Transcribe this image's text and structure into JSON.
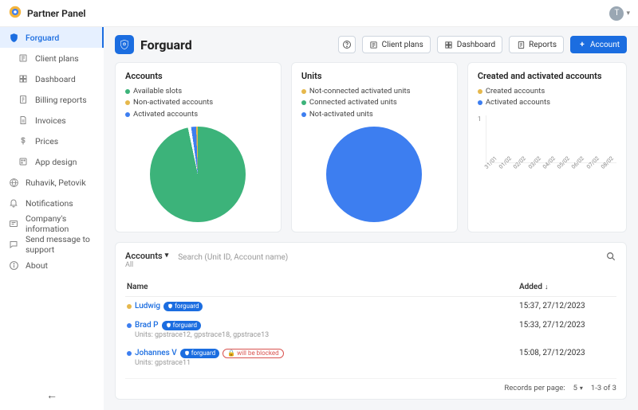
{
  "topbar": {
    "brand": "Partner Panel",
    "avatar_initial": "T"
  },
  "sidebar": {
    "items": [
      {
        "label": "Forguard",
        "icon": "shield-icon",
        "active": true,
        "child": false
      },
      {
        "label": "Client plans",
        "icon": "list-icon",
        "child": true
      },
      {
        "label": "Dashboard",
        "icon": "grid-icon",
        "child": true
      },
      {
        "label": "Billing reports",
        "icon": "report-icon",
        "child": true
      },
      {
        "label": "Invoices",
        "icon": "document-icon",
        "child": true
      },
      {
        "label": "Prices",
        "icon": "dollar-icon",
        "child": true
      },
      {
        "label": "App design",
        "icon": "palette-icon",
        "child": true
      },
      {
        "label": "Ruhavik, Petovik",
        "icon": "globe-icon",
        "child": false
      },
      {
        "label": "Notifications",
        "icon": "bell-icon",
        "child": false
      },
      {
        "label": "Company's information",
        "icon": "info-card-icon",
        "child": false
      },
      {
        "label": "Send message to support",
        "icon": "chat-icon",
        "child": false
      },
      {
        "label": "About",
        "icon": "about-icon",
        "child": false
      }
    ]
  },
  "page": {
    "title": "Forguard"
  },
  "header_buttons": {
    "client_plans": "Client plans",
    "dashboard": "Dashboard",
    "reports": "Reports",
    "account": "Account"
  },
  "cards": {
    "accounts_pie": {
      "title": "Accounts",
      "legend": [
        {
          "label": "Available slots",
          "color": "#3cb37a"
        },
        {
          "label": "Non-activated accounts",
          "color": "#e6b84c"
        },
        {
          "label": "Activated accounts",
          "color": "#3d7ef0"
        }
      ]
    },
    "units_pie": {
      "title": "Units",
      "legend": [
        {
          "label": "Not-connected activated units",
          "color": "#e6b84c"
        },
        {
          "label": "Connected activated units",
          "color": "#3cb37a"
        },
        {
          "label": "Not-activated units",
          "color": "#3d7ef0"
        }
      ]
    },
    "created": {
      "title": "Created and activated accounts",
      "legend": [
        {
          "label": "Created accounts",
          "color": "#e6b84c"
        },
        {
          "label": "Activated accounts",
          "color": "#3d7ef0"
        }
      ],
      "y_tick": "1",
      "x_ticks": [
        "31/01",
        "01/02",
        "02/02",
        "03/02",
        "04/02",
        "05/02",
        "06/02",
        "07/02",
        "08/02"
      ]
    }
  },
  "table": {
    "title": "Accounts",
    "filter": "All",
    "search_placeholder": "Search (Unit ID, Account name)",
    "columns": {
      "name": "Name",
      "added": "Added"
    },
    "rows": [
      {
        "status_color": "#e6b84c",
        "name": "Ludwig",
        "chips": [
          "forguard"
        ],
        "units": "",
        "added": "15:37, 27/12/2023"
      },
      {
        "status_color": "#3d7ef0",
        "name": "Brad P",
        "chips": [
          "forguard"
        ],
        "units": "Units: gpstrace12, gpstrace18, gpstrace13",
        "added": "15:33, 27/12/2023"
      },
      {
        "status_color": "#3d7ef0",
        "name": "Johannes V",
        "chips": [
          "forguard"
        ],
        "warn_chip": "will be blocked",
        "units": "Units: gpstrace11",
        "added": "15:08, 27/12/2023"
      }
    ],
    "pager": {
      "rows_label": "Records per page:",
      "rows_value": "5",
      "range": "1-3 of 3"
    }
  },
  "chart_data": [
    {
      "type": "pie",
      "title": "Accounts",
      "series": [
        {
          "name": "Available slots",
          "value": 97,
          "color": "#3cb37a"
        },
        {
          "name": "Non-activated accounts",
          "value": 1,
          "color": "#e6b84c"
        },
        {
          "name": "Activated accounts",
          "value": 2,
          "color": "#3d7ef0"
        }
      ]
    },
    {
      "type": "pie",
      "title": "Units",
      "series": [
        {
          "name": "Not-connected activated units",
          "value": 1,
          "color": "#e6b84c"
        },
        {
          "name": "Connected activated units",
          "value": 1,
          "color": "#3cb37a"
        },
        {
          "name": "Not-activated units",
          "value": 98,
          "color": "#3d7ef0"
        }
      ]
    },
    {
      "type": "line",
      "title": "Created and activated accounts",
      "x": [
        "31/01",
        "01/02",
        "02/02",
        "03/02",
        "04/02",
        "05/02",
        "06/02",
        "07/02",
        "08/02"
      ],
      "series": [
        {
          "name": "Created accounts",
          "values": [
            0,
            0,
            0,
            0,
            0,
            0,
            0,
            0,
            0
          ],
          "color": "#e6b84c"
        },
        {
          "name": "Activated accounts",
          "values": [
            0,
            0,
            0,
            0,
            0,
            0,
            0,
            0,
            0
          ],
          "color": "#3d7ef0"
        }
      ],
      "ylim": [
        0,
        1
      ],
      "xlabel": "",
      "ylabel": ""
    }
  ]
}
